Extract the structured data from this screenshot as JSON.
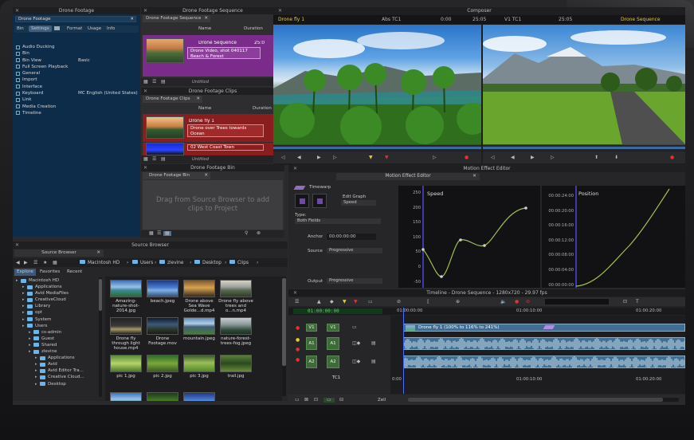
{
  "bins_panel": {
    "title": "Drone Footage",
    "search_value": "Drone Footage",
    "tabs": [
      "Bin",
      "Settings",
      "Format",
      "Usage",
      "Info"
    ],
    "settings": [
      {
        "label": "Audio Ducking",
        "value": ""
      },
      {
        "label": "Bin",
        "value": ""
      },
      {
        "label": "Bin View",
        "value": "Basic"
      },
      {
        "label": "Full Screen Playback",
        "value": ""
      },
      {
        "label": "General",
        "value": ""
      },
      {
        "label": "Import",
        "value": ""
      },
      {
        "label": "Interface",
        "value": ""
      },
      {
        "label": "Keyboard",
        "value": "MC English (United States)"
      },
      {
        "label": "Link",
        "value": ""
      },
      {
        "label": "Media Creation",
        "value": ""
      },
      {
        "label": "Timeline",
        "value": ""
      }
    ]
  },
  "seq_panel": {
    "title": "Drone Footage Sequence",
    "tab": "Drone Footage Sequence",
    "col_name": "Name",
    "col_duration": "Duration",
    "item_name": "Drone Sequence",
    "item_duration": "25:0",
    "item_desc": "Drone Video, shot 040117 Beach & Forest",
    "bin_label": "Untitled"
  },
  "clips_panel": {
    "title": "Drone Footage Clips",
    "col_name": "Name",
    "col_duration": "Duration",
    "clips": [
      {
        "name": "Drone fly 1",
        "desc": "Drone over Trees towards Ocean"
      },
      {
        "name": "02 West Coast Town",
        "desc": ""
      }
    ],
    "bin_label": "Untitled"
  },
  "bin_panel": {
    "title": "Drone Footage Bin",
    "tab": "Drone Footage Bin",
    "empty_msg": "Drag from Source Browser to add clips to Project"
  },
  "composer": {
    "title": "Composer",
    "source_name": "Drone fly 1",
    "source_tc_label": "Abs TC1",
    "source_tc": "0:00",
    "record_tc_label": "V1 TC1",
    "record_tc": "25:05",
    "source_tc2": "25:05",
    "record_name": "Drone Sequence"
  },
  "effect_editor": {
    "title": "Motion Effect Editor",
    "tab": "Motion Effect Editor",
    "timewarp_label": "Timewarp",
    "edit_graph_label": "Edit Graph",
    "edit_graph_value": "Speed",
    "type_label": "Type:",
    "type_value": "Both Fields",
    "anchor_label": "Anchor",
    "anchor_value": "00:00:00:00",
    "source_label": "Source",
    "source_value": "Progressive",
    "output_label": "Output",
    "output_value": "Progressive",
    "speed_graph": {
      "title": "Speed",
      "y_ticks": [
        "250",
        "200",
        "150",
        "100",
        "50",
        "0",
        "-50"
      ]
    },
    "position_graph": {
      "title": "Position",
      "y_ticks": [
        "00:00:24:00",
        "00:00:20:00",
        "00:00:16:00",
        "00:00:12:00",
        "00:00:08:00",
        "00:00:04:00",
        "00:00:00:00"
      ]
    }
  },
  "source_browser": {
    "title": "Source Browser",
    "tab": "Source Browser",
    "path": [
      "Macintosh HD",
      "Users",
      "zlevine",
      "Desktop",
      "Clips"
    ],
    "tabs": [
      "Explore",
      "Favorites",
      "Recent"
    ],
    "tree": [
      {
        "name": "Macintosh HD",
        "indent": 0
      },
      {
        "name": "Applications",
        "indent": 1
      },
      {
        "name": "Avid MediaFiles",
        "indent": 1
      },
      {
        "name": "CreativeCloud",
        "indent": 1
      },
      {
        "name": "Library",
        "indent": 1
      },
      {
        "name": "opt",
        "indent": 1
      },
      {
        "name": "System",
        "indent": 1
      },
      {
        "name": "Users",
        "indent": 1
      },
      {
        "name": "cs-admin",
        "indent": 2
      },
      {
        "name": "Guest",
        "indent": 2
      },
      {
        "name": "Shared",
        "indent": 2
      },
      {
        "name": "zlevine",
        "indent": 2
      },
      {
        "name": "Applications",
        "indent": 3
      },
      {
        "name": "Avid",
        "indent": 3
      },
      {
        "name": "Avid Editor Tra...",
        "indent": 3
      },
      {
        "name": "Creative Cloud...",
        "indent": 3
      },
      {
        "name": "Desktop",
        "indent": 3
      }
    ],
    "files": [
      {
        "name": "Amazing-nature-shot-2014.jpg",
        "img": "beach"
      },
      {
        "name": "beach.jpeg",
        "img": "sky"
      },
      {
        "name": "Drone above Sea Wave Golde...d.mp4",
        "img": "gold"
      },
      {
        "name": "Drone fly above trees and o...n.mp4",
        "img": "trees"
      },
      {
        "name": "Drone fly through light house.mp4",
        "img": "dark"
      },
      {
        "name": "Drone Footage.mov",
        "img": "road"
      },
      {
        "name": "mountain.jpeg",
        "img": "mount"
      },
      {
        "name": "nature-forest-trees-fog.jpeg",
        "img": "fog"
      },
      {
        "name": "pic 1.jpg",
        "img": "green"
      },
      {
        "name": "pic 2.jpg",
        "img": "green2"
      },
      {
        "name": "pic 3.jpg",
        "img": "field"
      },
      {
        "name": "trail.jpg",
        "img": "trail"
      },
      {
        "name": "",
        "img": "beach"
      },
      {
        "name": "",
        "img": "forest"
      },
      {
        "name": "",
        "img": "sky"
      }
    ]
  },
  "timeline": {
    "title": "Timeline - Drone Sequence - 1280x720 - 29.97 fps",
    "timecode": "01:00:00:00",
    "ruler": [
      "01:00:00:00",
      "01:00:10:00",
      "01:00:20:00"
    ],
    "ruler_bottom": [
      "0:00",
      "01:00:10:00",
      "01:00:20:00"
    ],
    "clip_label": "Drone fly 1 (100% to 116% to 241%)",
    "tracks": [
      "V1",
      "A1",
      "A2",
      "TC1"
    ],
    "zoom_label": "Zell"
  },
  "colors": {
    "panel_bg": "#2e2e30",
    "title_bg": "#1f1f21",
    "blue_bg": "#0d2c4a",
    "seq_purple": "#7b2c8a",
    "clip_red": "#8a1d1d",
    "accent": "#e8c93a",
    "timecode_green": "#5fd35f"
  },
  "icons": [
    "close-icon",
    "search-icon",
    "folder-icon",
    "play-icon",
    "pause-icon",
    "record-icon",
    "trash-icon",
    "grid-icon",
    "list-icon",
    "chevron-right-icon"
  ]
}
